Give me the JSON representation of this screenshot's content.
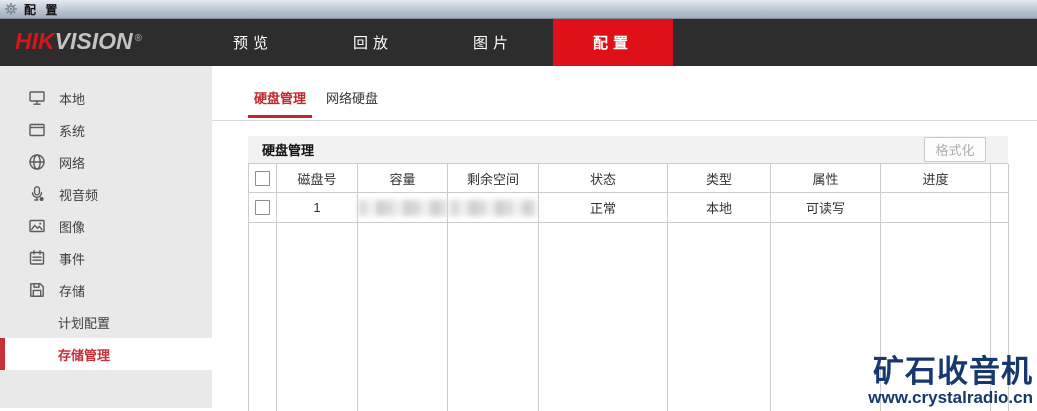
{
  "window": {
    "title": "配 置"
  },
  "brand": {
    "hik": "HIK",
    "vision": "VISION",
    "reg": "®"
  },
  "nav": {
    "tabs": [
      {
        "label": "预览",
        "active": false
      },
      {
        "label": "回放",
        "active": false
      },
      {
        "label": "图片",
        "active": false
      },
      {
        "label": "配置",
        "active": true
      }
    ]
  },
  "sidebar": {
    "items": [
      {
        "label": "本地",
        "icon": "monitor-icon",
        "sub": false,
        "active": false
      },
      {
        "label": "系统",
        "icon": "system-window-icon",
        "sub": false,
        "active": false
      },
      {
        "label": "网络",
        "icon": "globe-icon",
        "sub": false,
        "active": false
      },
      {
        "label": "视音频",
        "icon": "microphone-icon",
        "sub": false,
        "active": false
      },
      {
        "label": "图像",
        "icon": "image-icon",
        "sub": false,
        "active": false
      },
      {
        "label": "事件",
        "icon": "event-calendar-icon",
        "sub": false,
        "active": false
      },
      {
        "label": "存储",
        "icon": "storage-floppy-icon",
        "sub": false,
        "active": false
      },
      {
        "label": "计划配置",
        "sub": true,
        "active": false
      },
      {
        "label": "存储管理",
        "sub": true,
        "active": true
      }
    ]
  },
  "content": {
    "tabs": [
      {
        "label": "硬盘管理",
        "active": true
      },
      {
        "label": "网络硬盘",
        "active": false
      }
    ],
    "section_title": "硬盘管理",
    "format_button": "格式化",
    "table": {
      "columns": [
        "磁盘号",
        "容量",
        "剩余空间",
        "状态",
        "类型",
        "属性",
        "进度"
      ],
      "rows": [
        {
          "disk_no": "1",
          "capacity_redacted": true,
          "free_space_redacted": true,
          "status": "正常",
          "type": "本地",
          "property": "可读写",
          "progress": ""
        }
      ]
    }
  },
  "watermark": {
    "title": "矿石收音机",
    "url": "www.crystalradio.cn"
  },
  "colors": {
    "brand_red": "#e01019",
    "content_red": "#c4262c",
    "sidebar_red": "#c5303a",
    "header_dark": "#2d2d2d",
    "sidebar_bg": "#e9e9e9",
    "table_border": "#cccccc",
    "watermark_navy": "#16386e"
  }
}
